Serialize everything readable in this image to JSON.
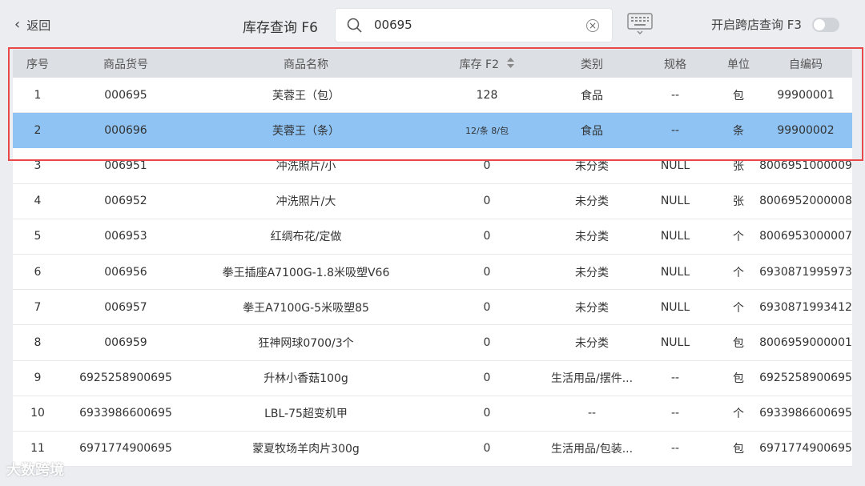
{
  "header": {
    "back_label": "返回",
    "title": "库存查询 F6",
    "search_value": "00695",
    "cross_store_label": "开启跨店查询 F3"
  },
  "table": {
    "columns": [
      "序号",
      "商品货号",
      "商品名称",
      "库存 F2",
      "类别",
      "规格",
      "单位",
      "自编码"
    ],
    "rows": [
      {
        "no": "1",
        "code": "000695",
        "name": "芙蓉王（包）",
        "stock": "128",
        "category": "食品",
        "spec": "--",
        "unit": "包",
        "selfcode": "99900001"
      },
      {
        "no": "2",
        "code": "000696",
        "name": "芙蓉王（条）",
        "stock": "12/条 8/包",
        "category": "食品",
        "spec": "--",
        "unit": "条",
        "selfcode": "99900002"
      },
      {
        "no": "3",
        "code": "006951",
        "name": "冲洗照片/小",
        "stock": "0",
        "category": "未分类",
        "spec": "NULL",
        "unit": "张",
        "selfcode": "8006951000009"
      },
      {
        "no": "4",
        "code": "006952",
        "name": "冲洗照片/大",
        "stock": "0",
        "category": "未分类",
        "spec": "NULL",
        "unit": "张",
        "selfcode": "8006952000008"
      },
      {
        "no": "5",
        "code": "006953",
        "name": "红绸布花/定做",
        "stock": "0",
        "category": "未分类",
        "spec": "NULL",
        "unit": "个",
        "selfcode": "8006953000007"
      },
      {
        "no": "6",
        "code": "006956",
        "name": "拳王插座A7100G-1.8米吸塑V66",
        "stock": "0",
        "category": "未分类",
        "spec": "NULL",
        "unit": "个",
        "selfcode": "6930871995973"
      },
      {
        "no": "7",
        "code": "006957",
        "name": "拳王A7100G-5米吸塑85",
        "stock": "0",
        "category": "未分类",
        "spec": "NULL",
        "unit": "个",
        "selfcode": "6930871993412"
      },
      {
        "no": "8",
        "code": "006959",
        "name": "狂神网球0700/3个",
        "stock": "0",
        "category": "未分类",
        "spec": "NULL",
        "unit": "包",
        "selfcode": "8006959000001"
      },
      {
        "no": "9",
        "code": "6925258900695",
        "name": "升林小香菇100g",
        "stock": "0",
        "category": "生活用品/摆件...",
        "spec": "--",
        "unit": "包",
        "selfcode": "6925258900695"
      },
      {
        "no": "10",
        "code": "6933986600695",
        "name": "LBL-75超变机甲",
        "stock": "0",
        "category": "--",
        "spec": "--",
        "unit": "个",
        "selfcode": "6933986600695"
      },
      {
        "no": "11",
        "code": "6971774900695",
        "name": "蒙夏牧场羊肉片300g",
        "stock": "0",
        "category": "生活用品/包装...",
        "spec": "--",
        "unit": "包",
        "selfcode": "6971774900695"
      }
    ]
  },
  "watermark": "大数跨境",
  "colors": {
    "selected_row": "#8ec3f4",
    "highlight_border": "#e84848",
    "header_bg": "#dcdfe4"
  }
}
